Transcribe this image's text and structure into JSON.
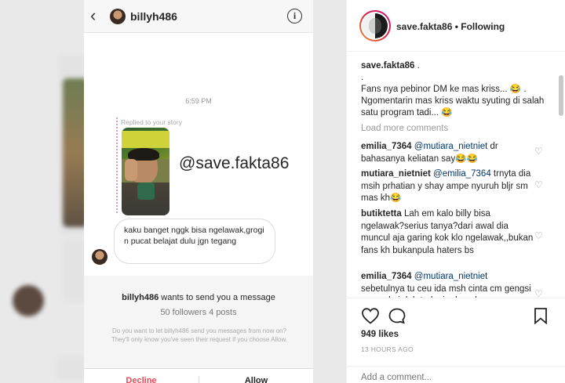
{
  "dm_screenshot": {
    "header_username": "billyh486",
    "info_glyph": "i",
    "back_glyph": "‹",
    "timestamp": "6:59 PM",
    "replied_label": "Replied to your story",
    "story_mention": "@save.fakta86",
    "message": "kaku banget nggk bisa ngelawak,grogi n pucat belajat dulu jgn tegang",
    "request": {
      "username": "billyh486",
      "title_rest": " wants to send you a message",
      "stats": "50 followers  4 posts",
      "description": "Do you want to let billyh486 send you messages from now on? They'll only know you've seen their request if you choose Allow.",
      "decline_label": "Decline",
      "allow_label": "Allow"
    }
  },
  "post": {
    "author": "save.fakta86",
    "separator": " • ",
    "follow_status": "Following",
    "caption_user": "save.fakta86",
    "caption_line1": " .",
    "caption_line2": ".",
    "caption_line3": "Fans nya pebinor DM ke mas kriss... 😂 .",
    "caption_line4": "Ngomentarin mas kriss waktu syuting di salah satu program tadi... 😂",
    "load_more": "Load more comments",
    "comments": [
      {
        "user": "emilia_7364",
        "mention": "@mutiara_nietniet",
        "text": " dr bahasanya keliatan say😂😂"
      },
      {
        "user": "mutiara_nietniet",
        "mention": "@emilia_7364",
        "text": " trnyta dia msih prhatian y shay ampe nyuruh bljr sm mas kh😂"
      },
      {
        "user": "butiktetta",
        "mention": "",
        "text": " Lah em kalo billy bisa ngelawak?serius tanya?dari awal dia muncul aja garing kok klo ngelawak,,bukan fans kh bukanpula haters bs"
      },
      {
        "user": "emilia_7364",
        "mention": "@mutiara_nietniet",
        "text": " sebetulnya tu ceu ida msh cinta cm gengsi mengakui dah terlanjur basah"
      }
    ],
    "likes": "949 likes",
    "time_ago": "13 HOURS AGO",
    "add_comment_placeholder": "Add a comment..."
  }
}
